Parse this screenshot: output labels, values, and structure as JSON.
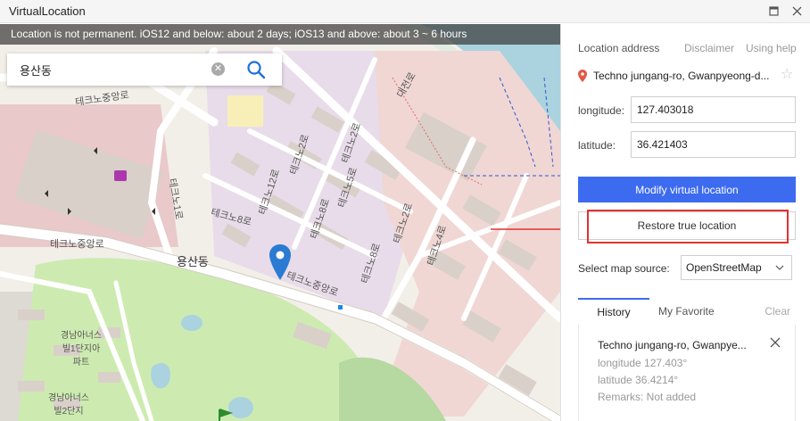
{
  "window": {
    "title": "VirtualLocation"
  },
  "map": {
    "notice": "Location is not permanent. iOS12 and below: about 2 days; iOS13 and above: about 3 ~ 6 hours",
    "search": {
      "value": "용산동",
      "placeholder": ""
    },
    "labels": {
      "area_name": "용산동",
      "road_main_a": "테크노중앙로",
      "road_main_b": "테크노중앙로",
      "road_main_c": "테크노중앙로",
      "road_2": "테크노2로",
      "road_2b": "테크노2로",
      "road_4": "테크노4로",
      "road_5": "테크노5로",
      "road_8": "테크노8로",
      "road_8b": "테크노8로",
      "road_12": "테크노12로",
      "road_1": "테크노1로",
      "road_daejeon": "대전로",
      "apt1": "경남아너스빌1단지아파트",
      "apt2": "경남아너스빌2단지"
    }
  },
  "panel": {
    "location_address_label": "Location address",
    "disclaimer": "Disclaimer",
    "using_help": "Using help",
    "address": "Techno jungang-ro, Gwanpyeong-d...",
    "longitude_label": "longitude:",
    "longitude_value": "127.403018",
    "latitude_label": "latitude:",
    "latitude_value": "36.421403",
    "modify_button": "Modify virtual location",
    "restore_button": "Restore true location",
    "map_source_label": "Select map source:",
    "map_source_value": "OpenStreetMap",
    "tabs": {
      "history": "History",
      "favorite": "My Favorite",
      "clear": "Clear"
    },
    "history": [
      {
        "title": "Techno jungang-ro, Gwanpye...",
        "longitude": "longitude 127.403°",
        "latitude": "latitude 36.4214°",
        "remarks": "Remarks: Not added"
      }
    ]
  },
  "colors": {
    "accent": "#3d6bf0",
    "highlight": "#e03232",
    "pin": "#2a7bd1"
  },
  "icons": [
    "location-pin-icon",
    "star-icon",
    "search-icon",
    "clear-icon",
    "chevron-down-icon",
    "close-icon",
    "minimize-icon",
    "maximize-icon",
    "shopping-icon",
    "golf-icon"
  ]
}
